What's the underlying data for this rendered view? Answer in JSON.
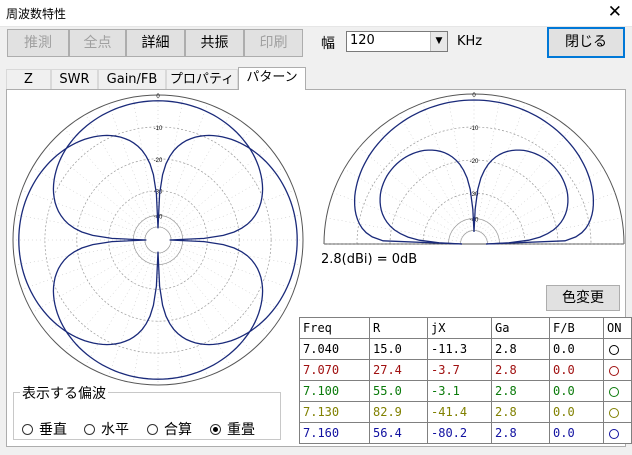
{
  "window": {
    "title": "周波数特性",
    "close_glyph": "✕"
  },
  "toolbar": {
    "buttons": [
      {
        "label": "推測",
        "enabled": false
      },
      {
        "label": "全点",
        "enabled": false
      },
      {
        "label": "詳細",
        "enabled": true
      },
      {
        "label": "共振",
        "enabled": true
      },
      {
        "label": "印刷",
        "enabled": false
      }
    ],
    "width_label": "幅",
    "width_value": "120",
    "width_unit": "KHz",
    "close_label": "閉じる"
  },
  "tabs": [
    {
      "label": "Z",
      "active": false
    },
    {
      "label": "SWR",
      "active": false
    },
    {
      "label": "Gain/FB",
      "active": false
    },
    {
      "label": "プロパティ",
      "active": false
    },
    {
      "label": "パターン",
      "active": true
    }
  ],
  "patterns": {
    "ring_labels": [
      "0",
      "-10",
      "-20",
      "-30",
      "-40"
    ],
    "trace_color": "#1a2a7a",
    "gain_reference": "2.8(dBi) = 0dB"
  },
  "color_button": "色変更",
  "table": {
    "headers": [
      "Freq",
      "R",
      "jX",
      "Ga",
      "F/B",
      "ON"
    ],
    "rows": [
      {
        "freq": "7.040",
        "r": "15.0",
        "jx": "-11.3",
        "ga": "2.8",
        "fb": "0.0",
        "color": "#000000"
      },
      {
        "freq": "7.070",
        "r": "27.4",
        "jx": "-3.7",
        "ga": "2.8",
        "fb": "0.0",
        "color": "#a01010"
      },
      {
        "freq": "7.100",
        "r": "55.0",
        "jx": "-3.1",
        "ga": "2.8",
        "fb": "0.0",
        "color": "#0a7a0a"
      },
      {
        "freq": "7.130",
        "r": "82.9",
        "jx": "-41.4",
        "ga": "2.8",
        "fb": "0.0",
        "color": "#808000"
      },
      {
        "freq": "7.160",
        "r": "56.4",
        "jx": "-80.2",
        "ga": "2.8",
        "fb": "0.0",
        "color": "#1010a0"
      }
    ]
  },
  "polarization": {
    "legend": "表示する偏波",
    "options": [
      {
        "label": "垂直",
        "checked": false
      },
      {
        "label": "水平",
        "checked": false
      },
      {
        "label": "合算",
        "checked": false
      },
      {
        "label": "重畳",
        "checked": true
      }
    ]
  }
}
